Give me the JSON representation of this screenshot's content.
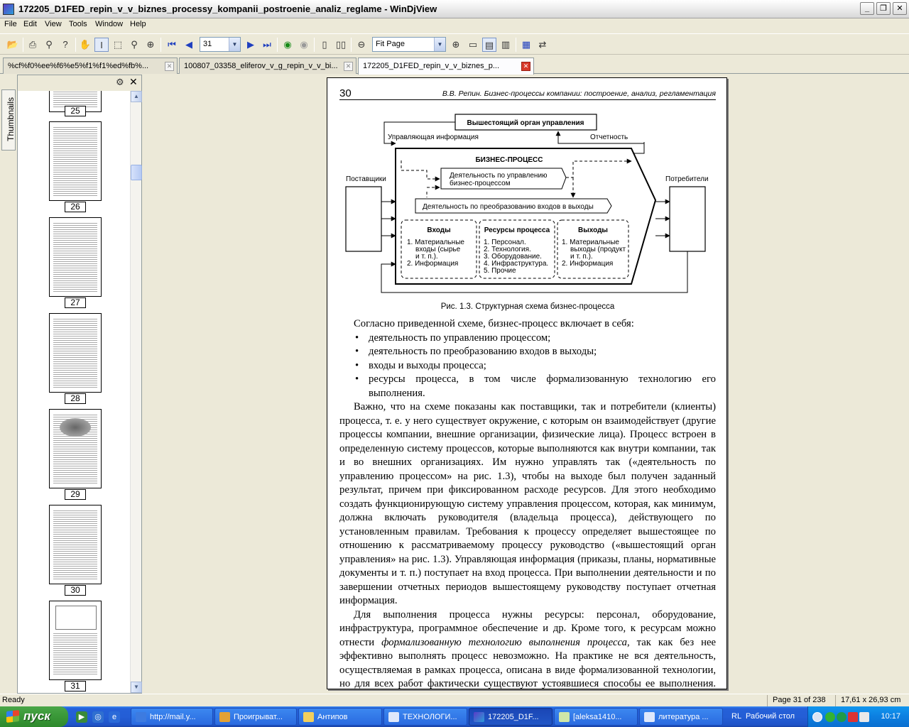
{
  "window": {
    "title": "172205_D1FED_repin_v_v_biznes_processy_kompanii_postroenie_analiz_reglame - WinDjView",
    "buttons": {
      "minimize": "_",
      "restore": "❐",
      "close": "✕"
    }
  },
  "menu": [
    "File",
    "Edit",
    "View",
    "Tools",
    "Window",
    "Help"
  ],
  "toolbar": {
    "page_input": "31",
    "zoom_select": "Fit Page"
  },
  "tabs": [
    {
      "label": "%cf%f0%ee%f6%e5%f1%f1%ed%fb%..."
    },
    {
      "label": "100807_03358_eliferov_v_g_repin_v_v_bi..."
    },
    {
      "label": "172205_D1FED_repin_v_v_biznes_p..."
    }
  ],
  "sidebar": {
    "tab_label": "Thumbnails",
    "pages": [
      "25",
      "26",
      "27",
      "28",
      "29",
      "30",
      "31"
    ]
  },
  "document": {
    "page_number": "30",
    "running_title": "В.В. Репин. Бизнес-процессы компании: построение, анализ, регламентация",
    "diagram": {
      "top_box": "Вышестоящий орган управления",
      "control_info": "Управляющая информация",
      "report": "Отчетность",
      "process_title": "БИЗНЕС-ПРОЦЕСС",
      "mgmt_activity_1": "Деятельность по управлению",
      "mgmt_activity_2": "бизнес-процессом",
      "transform_activity": "Деятельность по преобразованию входов в выходы",
      "suppliers": "Поставщики",
      "consumers": "Потребители",
      "inputs_title": "Входы",
      "inputs_items": [
        "1. Материальные",
        "входы (сырье",
        "и т. п.).",
        "2. Информация"
      ],
      "resources_title": "Ресурсы процесса",
      "resources_items": [
        "1. Персонал.",
        "2. Технология.",
        "3. Оборудование.",
        "4. Инфраструктура.",
        "5. Прочие"
      ],
      "outputs_title": "Выходы",
      "outputs_items": [
        "1. Материальные",
        "выходы (продукт",
        "и т. п.).",
        "2. Информация"
      ]
    },
    "caption": "Рис. 1.3. Структурная схема бизнес-процесса",
    "intro": "Согласно приведенной схеме, бизнес-процесс включает в себя:",
    "bullets": [
      "деятельность по управлению процессом;",
      "деятельность по преобразованию входов в выходы;",
      "входы и выходы процесса;",
      "ресурсы процесса, в том числе формализованную технологию его выполнения."
    ],
    "para1": "Важно, что на схеме показаны как поставщики, так и потребители (клиенты) процесса, т. е. у него существует окружение, с которым он взаимодействует (другие процессы компании, внешние организации, физические лица). Процесс встроен в определенную систему процессов, которые выполняются как внутри компании, так и во внешних организациях. Им нужно управлять так («деятельность по управлению процессом» на рис. 1.3), чтобы на выходе был получен заданный результат, причем при фиксированном расходе ресурсов. Для этого необходимо создать функционирующую систему управления процессом, которая, как минимум, должна включать руководителя (владельца процесса), действующего по установленным правилам. Требования к процессу определяет вышестоящее по отношению к рассматриваемому процессу руководство («вышестоящий орган управления» на рис. 1.3). Управляющая информация (приказы, планы, нормативные документы и т. п.) поступает на вход процесса. При выполнении деятельности и по завершении отчетных периодов вышестоящему руководству поступает отчетная информация.",
    "para2_a": "Для выполнения процесса нужны ресурсы: персонал, оборудование, инфраструктура, программное обеспечение и др. Кроме того, к ресурсам можно отнести ",
    "para2_em": "формализованную технологию выполнения процесса",
    "para2_b": ", так как без нее эффективно выполнять процесс невозможно. На практике не вся деятельность, осуществляемая в рамках процесса, описана в виде формализованной технологии, но для всех работ фактически существуют устоявшиеся способы ее выполнения. Часть"
  },
  "status": {
    "ready": "Ready",
    "page_info": "Page 31 of 238",
    "size": "17,61 x 26,93 cm"
  },
  "taskbar": {
    "start": "пуск",
    "items": [
      "http://mail.y...",
      "Проигрыват...",
      "Антипов",
      "ТЕХНОЛОГИ...",
      "172205_D1F...",
      "[aleksa1410...",
      "литература ..."
    ],
    "lang": "RL",
    "desktop": "Рабочий стол",
    "clock": "10:17"
  }
}
